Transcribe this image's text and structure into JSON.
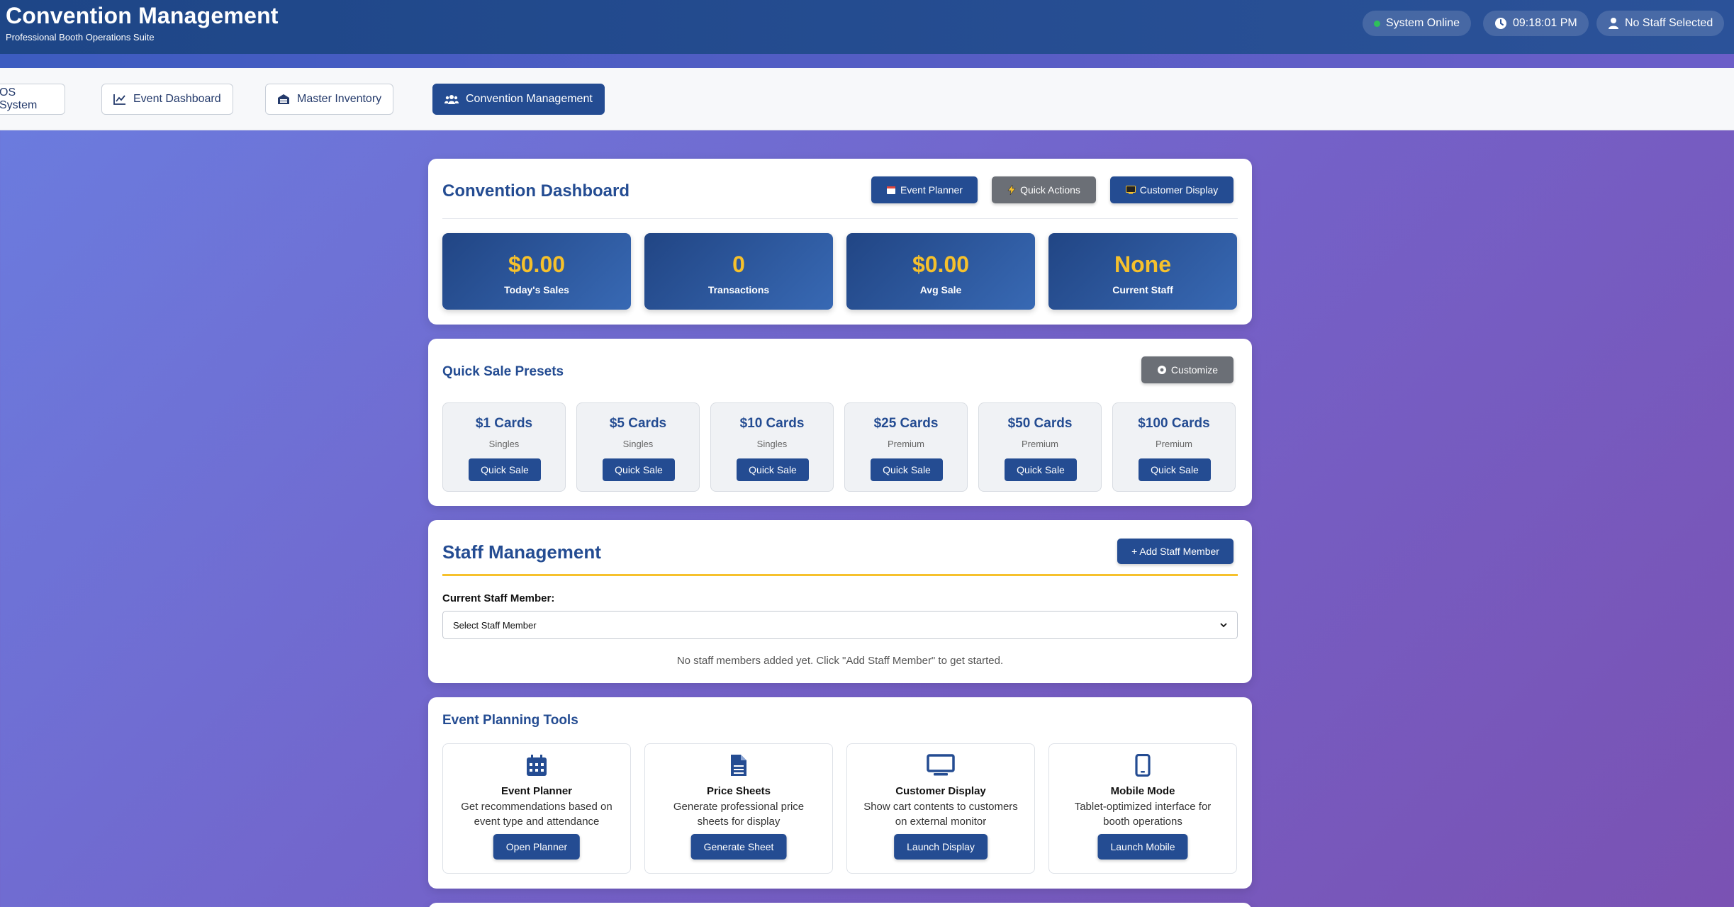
{
  "header": {
    "title": "Convention Management",
    "subtitle": "Professional Booth Operations Suite",
    "status": "System Online",
    "time": "09:18:01 PM",
    "staff": "No Staff Selected"
  },
  "nav": {
    "items": [
      {
        "label": "OS System"
      },
      {
        "label": "Event Dashboard"
      },
      {
        "label": "Master Inventory"
      },
      {
        "label": "Convention Management"
      }
    ]
  },
  "dashboard": {
    "title": "Convention Dashboard",
    "buttons": {
      "planner": "Event Planner",
      "quick": "Quick Actions",
      "display": "Customer Display"
    },
    "stats": [
      {
        "value": "$0.00",
        "label": "Today's Sales"
      },
      {
        "value": "0",
        "label": "Transactions"
      },
      {
        "value": "$0.00",
        "label": "Avg Sale"
      },
      {
        "value": "None",
        "label": "Current Staff"
      }
    ]
  },
  "presets": {
    "title": "Quick Sale Presets",
    "customize": "Customize",
    "items": [
      {
        "name": "$1 Cards",
        "category": "Singles",
        "action": "Quick Sale"
      },
      {
        "name": "$5 Cards",
        "category": "Singles",
        "action": "Quick Sale"
      },
      {
        "name": "$10 Cards",
        "category": "Singles",
        "action": "Quick Sale"
      },
      {
        "name": "$25 Cards",
        "category": "Premium",
        "action": "Quick Sale"
      },
      {
        "name": "$50 Cards",
        "category": "Premium",
        "action": "Quick Sale"
      },
      {
        "name": "$100 Cards",
        "category": "Premium",
        "action": "Quick Sale"
      }
    ]
  },
  "staff": {
    "title": "Staff Management",
    "add": "+ Add Staff Member",
    "current_label": "Current Staff Member:",
    "select_value": "Select Staff Member",
    "empty": "No staff members added yet. Click \"Add Staff Member\" to get started."
  },
  "tools": {
    "title": "Event Planning Tools",
    "items": [
      {
        "name": "Event Planner",
        "line1": "Get recommendations based on",
        "line2": "event type and attendance",
        "action": "Open Planner"
      },
      {
        "name": "Price Sheets",
        "line1": "Generate professional price",
        "line2": "sheets for display",
        "action": "Generate Sheet"
      },
      {
        "name": "Customer Display",
        "line1": "Show cart contents to customers",
        "line2": "on external monitor",
        "action": "Launch Display"
      },
      {
        "name": "Mobile Mode",
        "line1": "Tablet-optimized interface for",
        "line2": "booth operations",
        "action": "Launch Mobile"
      }
    ]
  }
}
